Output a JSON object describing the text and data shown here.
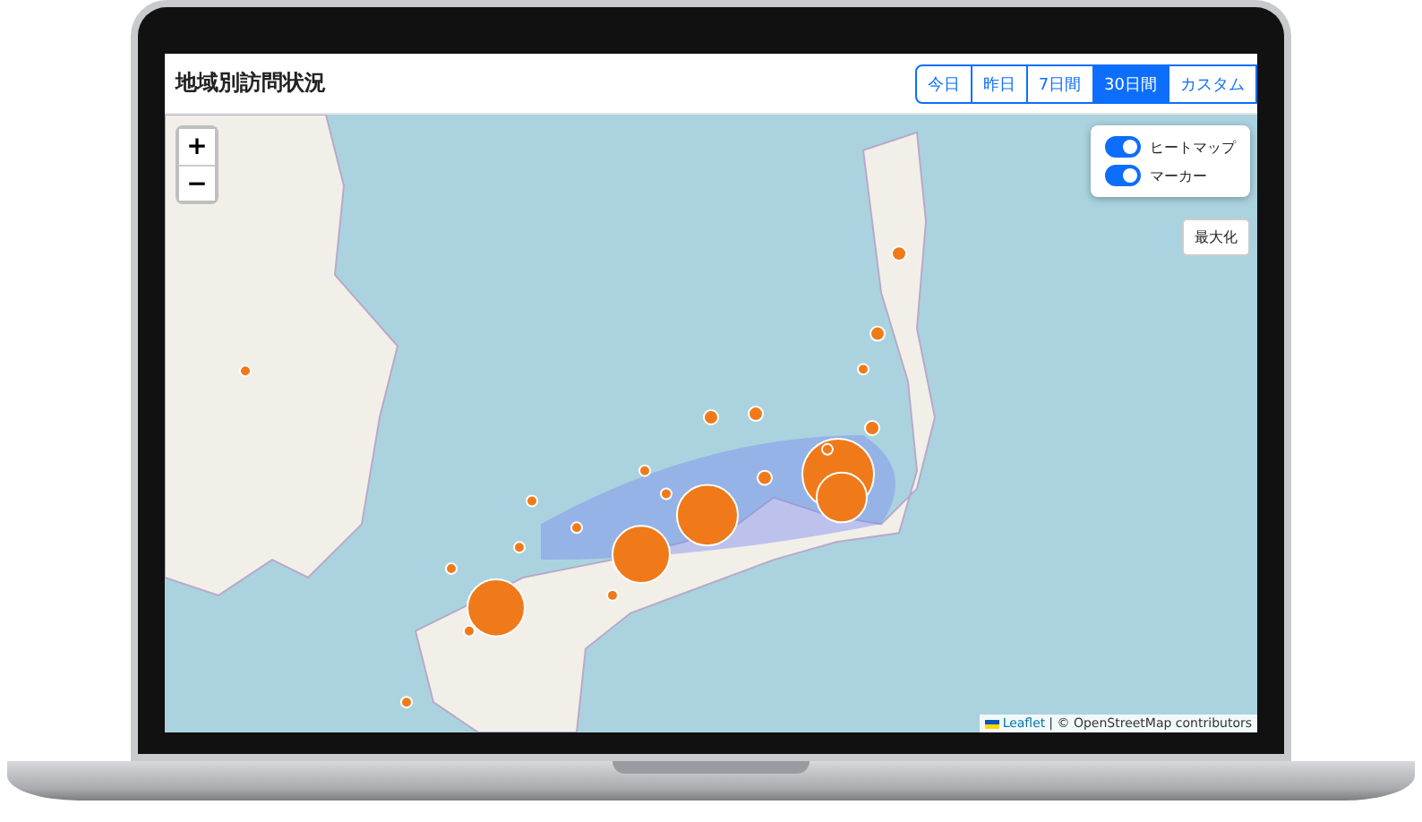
{
  "window": {
    "title": "地域別訪問状況"
  },
  "range_tabs": [
    {
      "label": "今日",
      "selected": false
    },
    {
      "label": "昨日",
      "selected": false
    },
    {
      "label": "7日間",
      "selected": false
    },
    {
      "label": "30日間",
      "selected": true
    },
    {
      "label": "カスタム",
      "selected": false
    }
  ],
  "map": {
    "zoom_in": "+",
    "zoom_out": "−",
    "layers": [
      {
        "label": "ヒートマップ",
        "on": true
      },
      {
        "label": "マーカー",
        "on": true
      }
    ],
    "maximize_button": "最大化",
    "attribution": {
      "link": "Leaflet",
      "text": "| © OpenStreetMap contributors"
    }
  }
}
